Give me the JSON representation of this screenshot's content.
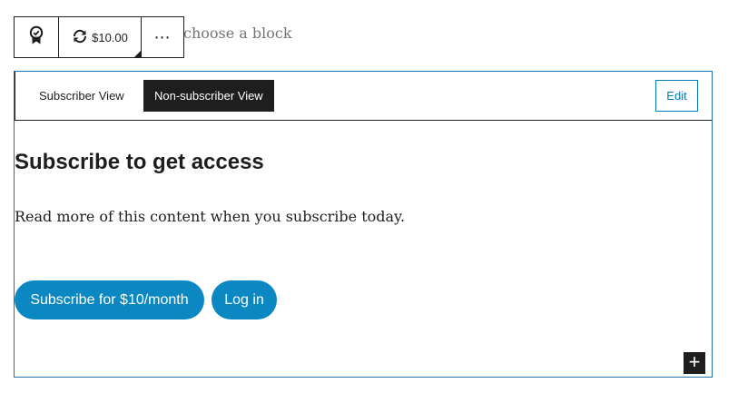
{
  "toolbar": {
    "badge_icon": "award-badge-icon",
    "price_icon": "recurring-refresh-icon",
    "price_label": "$10.00",
    "more_label": "⋯"
  },
  "placeholder": "choose a block",
  "view_switch": {
    "subscriber_label": "Subscriber View",
    "non_subscriber_label": "Non-subscriber View",
    "active": "Non-subscriber View",
    "edit_label": "Edit"
  },
  "content": {
    "heading": "Subscribe to get access",
    "paragraph": "Read more of this content when you subscribe today.",
    "subscribe_button": "Subscribe for $10/month",
    "login_button": "Log in"
  },
  "add_block": {
    "label": "+"
  },
  "colors": {
    "accent": "#007cba",
    "button": "#0b88c2",
    "dark": "#1e1e1e"
  }
}
